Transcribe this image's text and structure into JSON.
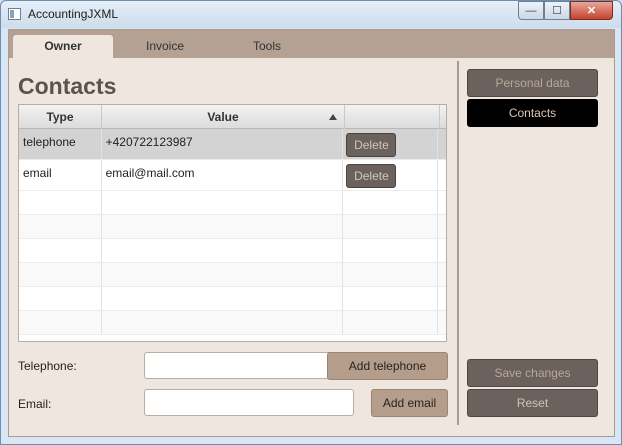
{
  "window": {
    "title": "AccountingJXML",
    "minimize": "—",
    "maximize": "☐",
    "close": "✕"
  },
  "tabs": [
    {
      "label": "Owner",
      "active": true
    },
    {
      "label": "Invoice",
      "active": false
    },
    {
      "label": "Tools",
      "active": false
    }
  ],
  "heading": "Contacts",
  "table": {
    "columns": [
      "Type",
      "Value"
    ],
    "sort": {
      "column": "Value",
      "direction": "ascending"
    },
    "rows": [
      {
        "type": "telephone",
        "value": "+420722123987",
        "action": "Delete",
        "selected": true
      },
      {
        "type": "email",
        "value": "email@mail.com",
        "action": "Delete",
        "selected": false
      }
    ]
  },
  "form": {
    "telephone_label": "Telephone:",
    "telephone_value": "",
    "add_telephone": "Add telephone",
    "email_label": "Email:",
    "email_value": "",
    "add_email": "Add email"
  },
  "side": {
    "personal_data": "Personal data",
    "contacts": "Contacts",
    "save_changes": "Save changes",
    "reset": "Reset"
  },
  "colors": {
    "accent": "#b49d8b",
    "tabbar": "#b5a193",
    "background": "#efe6df"
  }
}
